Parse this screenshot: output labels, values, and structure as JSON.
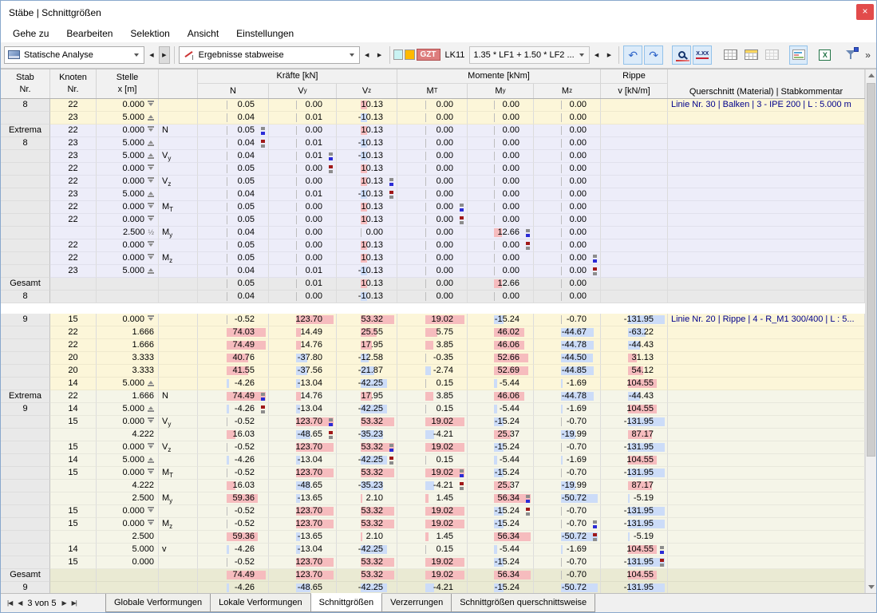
{
  "window": {
    "title": "Stäbe | Schnittgrößen",
    "close_glyph": "×"
  },
  "menu": {
    "items": [
      "Gehe zu",
      "Bearbeiten",
      "Selektion",
      "Ansicht",
      "Einstellungen"
    ]
  },
  "toolbar": {
    "analysis_combo": "Statische Analyse",
    "results_combo": "Ergebnisse stabweise",
    "gzt_badge": "GZT",
    "lk_label": "LK11",
    "load_combo": "1.35 * LF1 + 1.50 * LF2 ...",
    "undo_glyph": "↶",
    "redo_glyph": "↷",
    "xxx_label": "X.XX",
    "overflow_glyph": "»",
    "colors": {
      "swatch_cyan": "#c9f3f3",
      "swatch_orange": "#ffb900",
      "gzt_bg": "#dd7d7d",
      "selected_button_bg": "#dcebf9",
      "bar_positive": "#f6bcbe",
      "bar_negative": "#ccdcf8",
      "comment_text": "#00008b"
    }
  },
  "table": {
    "header": {
      "stab_l1": "Stab",
      "stab_l2": "Nr.",
      "knoten_l1": "Knoten",
      "knoten_l2": "Nr.",
      "stelle_l1": "Stelle",
      "stelle_l2": "x [m]",
      "kraefte_group": "Kräfte [kN]",
      "momente_group": "Momente [kNm]",
      "rippe_l1": "Rippe",
      "rippe_l2": "v [kN/m]",
      "force_cols": [
        [
          "N",
          ""
        ],
        [
          "V",
          "y"
        ],
        [
          "V",
          "z"
        ]
      ],
      "moment_cols": [
        [
          "M",
          "T"
        ],
        [
          "M",
          "y"
        ],
        [
          "M",
          "z"
        ]
      ],
      "querschnitt": "Querschnitt (Material) | Stabkommentar"
    },
    "sections": [
      {
        "cls": "s-d8",
        "rows": [
          {
            "g": "8",
            "k": "22",
            "x": "0.000",
            "xm": "s",
            "ex": "",
            "vals": [
              "0.05",
              "0.00",
              "10.13",
              "0.00",
              "0.00",
              "0.00",
              null
            ],
            "c": "Linie Nr. 30 | Balken | 3 - IPE 200 | L : 5.000 m"
          },
          {
            "g": "",
            "k": "23",
            "x": "5.000",
            "xm": "e",
            "ex": "",
            "vals": [
              "0.04",
              "0.01",
              "-10.13",
              "0.00",
              "0.00",
              "0.00",
              null
            ],
            "c": ""
          }
        ]
      },
      {
        "cls": "s-e8",
        "rows": [
          {
            "g": "Extrema",
            "k": "22",
            "x": "0.000",
            "xm": "s",
            "ex": "N",
            "vals": [
              [
                "0.05",
                "b"
              ],
              "0.00",
              "10.13",
              "0.00",
              "0.00",
              "0.00",
              null
            ]
          },
          {
            "g": "8",
            "k": "23",
            "x": "5.000",
            "xm": "e",
            "ex": "",
            "vals": [
              [
                "0.04",
                "r"
              ],
              "0.01",
              "-10.13",
              "0.00",
              "0.00",
              "0.00",
              null
            ]
          },
          {
            "g": "",
            "k": "23",
            "x": "5.000",
            "xm": "e",
            "ex": "Vy",
            "vals": [
              "0.04",
              [
                "0.01",
                "b"
              ],
              "-10.13",
              "0.00",
              "0.00",
              "0.00",
              null
            ]
          },
          {
            "g": "",
            "k": "22",
            "x": "0.000",
            "xm": "s",
            "ex": "",
            "vals": [
              "0.05",
              [
                "0.00",
                "r"
              ],
              "10.13",
              "0.00",
              "0.00",
              "0.00",
              null
            ]
          },
          {
            "g": "",
            "k": "22",
            "x": "0.000",
            "xm": "s",
            "ex": "Vz",
            "vals": [
              "0.05",
              "0.00",
              [
                "10.13",
                "b"
              ],
              "0.00",
              "0.00",
              "0.00",
              null
            ]
          },
          {
            "g": "",
            "k": "23",
            "x": "5.000",
            "xm": "e",
            "ex": "",
            "vals": [
              "0.04",
              "0.01",
              [
                "-10.13",
                "r"
              ],
              "0.00",
              "0.00",
              "0.00",
              null
            ]
          },
          {
            "g": "",
            "k": "22",
            "x": "0.000",
            "xm": "s",
            "ex": "MT",
            "vals": [
              "0.05",
              "0.00",
              "10.13",
              [
                "0.00",
                "b"
              ],
              "0.00",
              "0.00",
              null
            ]
          },
          {
            "g": "",
            "k": "22",
            "x": "0.000",
            "xm": "s",
            "ex": "",
            "vals": [
              "0.05",
              "0.00",
              "10.13",
              [
                "0.00",
                "r"
              ],
              "0.00",
              "0.00",
              null
            ]
          },
          {
            "g": "",
            "k": "",
            "x": "2.500",
            "xm": "h",
            "ex": "My",
            "vals": [
              "0.04",
              "0.00",
              "0.00",
              "0.00",
              [
                "12.66",
                "b"
              ],
              "0.00",
              null
            ]
          },
          {
            "g": "",
            "k": "22",
            "x": "0.000",
            "xm": "s",
            "ex": "",
            "vals": [
              "0.05",
              "0.00",
              "10.13",
              "0.00",
              [
                "0.00",
                "r"
              ],
              "0.00",
              null
            ]
          },
          {
            "g": "",
            "k": "22",
            "x": "0.000",
            "xm": "s",
            "ex": "Mz",
            "vals": [
              "0.05",
              "0.00",
              "10.13",
              "0.00",
              "0.00",
              [
                "0.00",
                "b"
              ],
              null
            ]
          },
          {
            "g": "",
            "k": "23",
            "x": "5.000",
            "xm": "e",
            "ex": "",
            "vals": [
              "0.04",
              "0.01",
              "-10.13",
              "0.00",
              "0.00",
              [
                "0.00",
                "r"
              ],
              null
            ]
          }
        ]
      },
      {
        "cls": "s-g8",
        "rows": [
          {
            "g": "Gesamt",
            "k": "",
            "x": "",
            "xm": "",
            "ex": "",
            "vals": [
              "0.05",
              "0.01",
              "10.13",
              "0.00",
              "12.66",
              "0.00",
              null
            ]
          },
          {
            "g": "8",
            "k": "",
            "x": "",
            "xm": "",
            "ex": "",
            "vals": [
              "0.04",
              "0.00",
              "-10.13",
              "0.00",
              "0.00",
              "0.00",
              null
            ]
          }
        ]
      },
      {
        "cls": "gap"
      },
      {
        "cls": "s-d9",
        "rows": [
          {
            "g": "9",
            "k": "15",
            "x": "0.000",
            "xm": "s",
            "ex": "",
            "vals": [
              "-0.52",
              "123.70",
              "53.32",
              "19.02",
              "-15.24",
              "-0.70",
              "-131.95"
            ],
            "c": "Linie Nr. 20 | Rippe | 4 - R_M1 300/400 | L : 5..."
          },
          {
            "g": "",
            "k": "22",
            "x": "1.666",
            "xm": "",
            "ex": "",
            "vals": [
              "74.03",
              "14.49",
              "25.55",
              "5.75",
              "46.02",
              "-44.67",
              "-63.22"
            ]
          },
          {
            "g": "",
            "k": "22",
            "x": "1.666",
            "xm": "",
            "ex": "",
            "vals": [
              "74.49",
              "14.76",
              "17.95",
              "3.85",
              "46.06",
              "-44.78",
              "-44.43"
            ]
          },
          {
            "g": "",
            "k": "20",
            "x": "3.333",
            "xm": "",
            "ex": "",
            "vals": [
              "40.76",
              "-37.80",
              "-12.58",
              "-0.35",
              "52.66",
              "-44.50",
              "31.13"
            ]
          },
          {
            "g": "",
            "k": "20",
            "x": "3.333",
            "xm": "",
            "ex": "",
            "vals": [
              "41.55",
              "-37.56",
              "-21.87",
              "-2.74",
              "52.69",
              "-44.85",
              "54.12"
            ]
          },
          {
            "g": "",
            "k": "14",
            "x": "5.000",
            "xm": "e",
            "ex": "",
            "vals": [
              "-4.26",
              "-13.04",
              "-42.25",
              "0.15",
              "-5.44",
              "-1.69",
              "104.55"
            ]
          }
        ]
      },
      {
        "cls": "s-e9",
        "rows": [
          {
            "g": "Extrema",
            "k": "22",
            "x": "1.666",
            "xm": "",
            "ex": "N",
            "vals": [
              [
                "74.49",
                "b"
              ],
              "14.76",
              "17.95",
              "3.85",
              "46.06",
              "-44.78",
              "-44.43"
            ]
          },
          {
            "g": "9",
            "k": "14",
            "x": "5.000",
            "xm": "e",
            "ex": "",
            "vals": [
              [
                "-4.26",
                "r"
              ],
              "-13.04",
              "-42.25",
              "0.15",
              "-5.44",
              "-1.69",
              "104.55"
            ]
          },
          {
            "g": "",
            "k": "15",
            "x": "0.000",
            "xm": "s",
            "ex": "Vy",
            "vals": [
              "-0.52",
              [
                "123.70",
                "b"
              ],
              "53.32",
              "19.02",
              "-15.24",
              "-0.70",
              "-131.95"
            ]
          },
          {
            "g": "",
            "k": "",
            "x": "4.222",
            "xm": "",
            "ex": "",
            "vals": [
              "16.03",
              [
                "-48.65",
                "r"
              ],
              "-35.23",
              "-4.21",
              "25.37",
              "-19.99",
              "87.17"
            ]
          },
          {
            "g": "",
            "k": "15",
            "x": "0.000",
            "xm": "s",
            "ex": "Vz",
            "vals": [
              "-0.52",
              "123.70",
              [
                "53.32",
                "b"
              ],
              "19.02",
              "-15.24",
              "-0.70",
              "-131.95"
            ]
          },
          {
            "g": "",
            "k": "14",
            "x": "5.000",
            "xm": "e",
            "ex": "",
            "vals": [
              "-4.26",
              "-13.04",
              [
                "-42.25",
                "r"
              ],
              "0.15",
              "-5.44",
              "-1.69",
              "104.55"
            ]
          },
          {
            "g": "",
            "k": "15",
            "x": "0.000",
            "xm": "s",
            "ex": "MT",
            "vals": [
              "-0.52",
              "123.70",
              "53.32",
              [
                "19.02",
                "b"
              ],
              "-15.24",
              "-0.70",
              "-131.95"
            ]
          },
          {
            "g": "",
            "k": "",
            "x": "4.222",
            "xm": "",
            "ex": "",
            "vals": [
              "16.03",
              "-48.65",
              "-35.23",
              [
                "-4.21",
                "r"
              ],
              "25.37",
              "-19.99",
              "87.17"
            ]
          },
          {
            "g": "",
            "k": "",
            "x": "2.500",
            "xm": "",
            "ex": "My",
            "vals": [
              "59.36",
              "-13.65",
              "2.10",
              "1.45",
              [
                "56.34",
                "b"
              ],
              "-50.72",
              "-5.19"
            ]
          },
          {
            "g": "",
            "k": "15",
            "x": "0.000",
            "xm": "s",
            "ex": "",
            "vals": [
              "-0.52",
              "123.70",
              "53.32",
              "19.02",
              [
                "-15.24",
                "r"
              ],
              "-0.70",
              "-131.95"
            ]
          },
          {
            "g": "",
            "k": "15",
            "x": "0.000",
            "xm": "s",
            "ex": "Mz",
            "vals": [
              "-0.52",
              "123.70",
              "53.32",
              "19.02",
              "-15.24",
              [
                "-0.70",
                "b"
              ],
              "-131.95"
            ]
          },
          {
            "g": "",
            "k": "",
            "x": "2.500",
            "xm": "",
            "ex": "",
            "vals": [
              "59.36",
              "-13.65",
              "2.10",
              "1.45",
              "56.34",
              [
                "-50.72",
                "r"
              ],
              "-5.19"
            ]
          },
          {
            "g": "",
            "k": "14",
            "x": "5.000",
            "xm": "",
            "ex": "v",
            "vals": [
              "-4.26",
              "-13.04",
              "-42.25",
              "0.15",
              "-5.44",
              "-1.69",
              [
                "104.55",
                "b"
              ]
            ]
          },
          {
            "g": "",
            "k": "15",
            "x": "0.000",
            "xm": "",
            "ex": "",
            "vals": [
              "-0.52",
              "123.70",
              "53.32",
              "19.02",
              "-15.24",
              "-0.70",
              [
                "-131.95",
                "r"
              ]
            ]
          }
        ]
      },
      {
        "cls": "s-g9",
        "rows": [
          {
            "g": "Gesamt",
            "k": "",
            "x": "",
            "xm": "",
            "ex": "",
            "vals": [
              "74.49",
              "123.70",
              "53.32",
              "19.02",
              "56.34",
              "-0.70",
              "104.55"
            ]
          },
          {
            "g": "9",
            "k": "",
            "x": "",
            "xm": "",
            "ex": "",
            "vals": [
              "-4.26",
              "-48.65",
              "-42.25",
              "-4.21",
              "-15.24",
              "-50.72",
              "-131.95"
            ]
          }
        ]
      }
    ]
  },
  "bottombar": {
    "first_glyph": "|◀",
    "prev_glyph": "◀",
    "position": "3 von 5",
    "next_glyph": "▶",
    "last_glyph": "▶|",
    "tabs": [
      {
        "label": "Globale Verformungen",
        "active": false
      },
      {
        "label": "Lokale Verformungen",
        "active": false
      },
      {
        "label": "Schnittgrößen",
        "active": true
      },
      {
        "label": "Verzerrungen",
        "active": false
      },
      {
        "label": "Schnittgrößen querschnittsweise",
        "active": false
      }
    ]
  }
}
